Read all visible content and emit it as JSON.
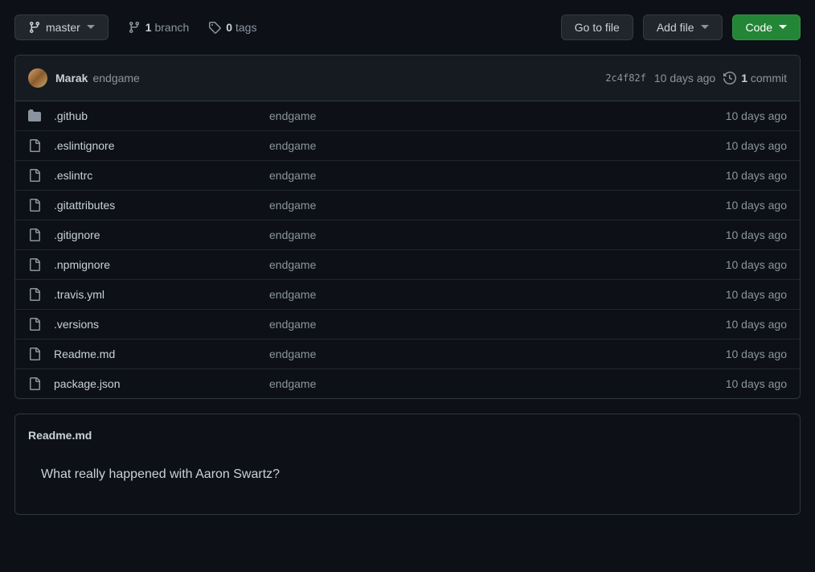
{
  "toolbar": {
    "branch": "master",
    "branch_count": "1",
    "branch_label": "branch",
    "tag_count": "0",
    "tag_label": "tags",
    "go_to_file": "Go to file",
    "add_file": "Add file",
    "code": "Code"
  },
  "commit": {
    "author": "Marak",
    "message": "endgame",
    "sha": "2c4f82f",
    "time": "10 days ago",
    "count": "1",
    "count_label": "commit"
  },
  "files": [
    {
      "name": ".github",
      "message": "endgame",
      "time": "10 days ago",
      "type": "dir"
    },
    {
      "name": ".eslintignore",
      "message": "endgame",
      "time": "10 days ago",
      "type": "file"
    },
    {
      "name": ".eslintrc",
      "message": "endgame",
      "time": "10 days ago",
      "type": "file"
    },
    {
      "name": ".gitattributes",
      "message": "endgame",
      "time": "10 days ago",
      "type": "file"
    },
    {
      "name": ".gitignore",
      "message": "endgame",
      "time": "10 days ago",
      "type": "file"
    },
    {
      "name": ".npmignore",
      "message": "endgame",
      "time": "10 days ago",
      "type": "file"
    },
    {
      "name": ".travis.yml",
      "message": "endgame",
      "time": "10 days ago",
      "type": "file"
    },
    {
      "name": ".versions",
      "message": "endgame",
      "time": "10 days ago",
      "type": "file"
    },
    {
      "name": "Readme.md",
      "message": "endgame",
      "time": "10 days ago",
      "type": "file"
    },
    {
      "name": "package.json",
      "message": "endgame",
      "time": "10 days ago",
      "type": "file"
    }
  ],
  "readme": {
    "filename": "Readme.md",
    "body": "What really happened with Aaron Swartz?"
  }
}
